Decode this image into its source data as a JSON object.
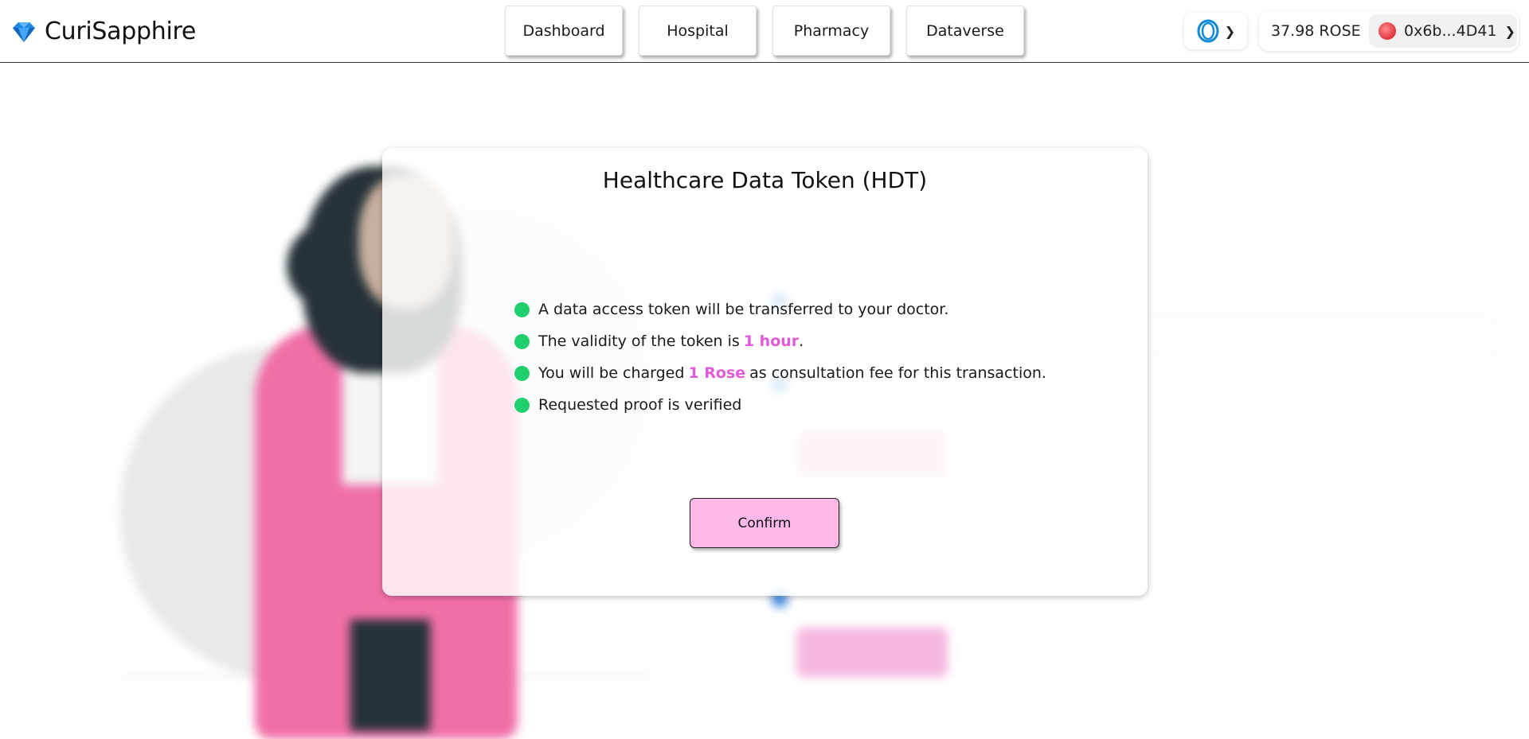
{
  "header": {
    "brand": "CuriSapphire",
    "nav": [
      {
        "label": "Dashboard"
      },
      {
        "label": "Hospital"
      },
      {
        "label": "Pharmacy"
      },
      {
        "label": "Dataverse"
      }
    ],
    "network_icon": "oasis-ring-icon",
    "balance": "37.98 ROSE",
    "address": "0x6b...4D41"
  },
  "modal": {
    "title": "Healthcare Data Token (HDT)",
    "items": [
      {
        "text": "A data access token will be transferred to your doctor."
      },
      {
        "pre": "The validity of the token is",
        "highlight": "1 hour",
        "post": "."
      },
      {
        "pre": "You will be charged",
        "highlight": "1 Rose",
        "post": "as consultation fee for this transaction."
      },
      {
        "text": "Requested proof is verified"
      }
    ],
    "confirm_label": "Confirm"
  },
  "colors": {
    "accent_pink": "#fdb8ea",
    "highlight": "#e25ad9",
    "check_green": "#1fcf6d"
  }
}
